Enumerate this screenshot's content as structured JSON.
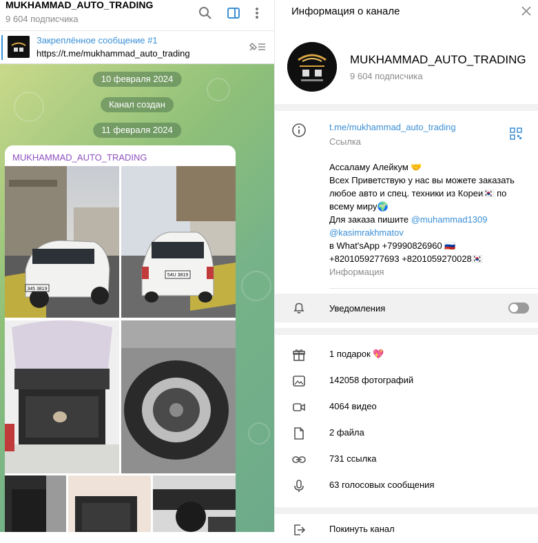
{
  "chat": {
    "title": "MUKHAMMAD_AUTO_TRADING",
    "subscribers": "9 604 подписчика",
    "pinned_title": "Закреплённое сообщение #1",
    "pinned_text": "https://t.me/mukhammad_auto_trading",
    "dates": [
      "10 февраля 2024",
      "Канал создан",
      "11 февраля 2024"
    ],
    "post_author": "MUKHAMMAD_AUTO_TRADING",
    "plate1": "345 3819",
    "plate2": "54U 3819"
  },
  "info": {
    "title": "Информация о канале",
    "channel_name": "MUKHAMMAD_AUTO_TRADING",
    "subscribers": "9 604 подписчика",
    "link": "t.me/mukhammad_auto_trading",
    "link_label": "Ссылка",
    "description": {
      "line1": "Ассаламу Алейкум 🤝",
      "line2": "Всех Приветствую у нас вы можете заказать любое авто и спец. техники из Кореи🇰🇷 по всему миру🌍",
      "line3_prefix": "Для заказа пишите ",
      "mention1": "@muhammad1309",
      "mention2": "@kasimrakhmatov",
      "line4": "в What'sApp +79990826960 🇷🇺",
      "line5": "+8201059277693  +8201059270028🇰🇷"
    },
    "description_label": "Информация",
    "notifications_label": "Уведомления",
    "notifications_on": false,
    "media": [
      {
        "icon": "gift-icon",
        "label": "1 подарок 💖"
      },
      {
        "icon": "photo-icon",
        "label": "142058 фотографий"
      },
      {
        "icon": "video-icon",
        "label": "4064 видео"
      },
      {
        "icon": "file-icon",
        "label": "2 файла"
      },
      {
        "icon": "link-icon",
        "label": "731 ссылка"
      },
      {
        "icon": "mic-icon",
        "label": "63 голосовых сообщения"
      }
    ],
    "leave_label": "Покинуть канал"
  },
  "colors": {
    "accent": "#3a8fd6",
    "author": "#8e4fbf",
    "muted": "#8a8a8a"
  }
}
